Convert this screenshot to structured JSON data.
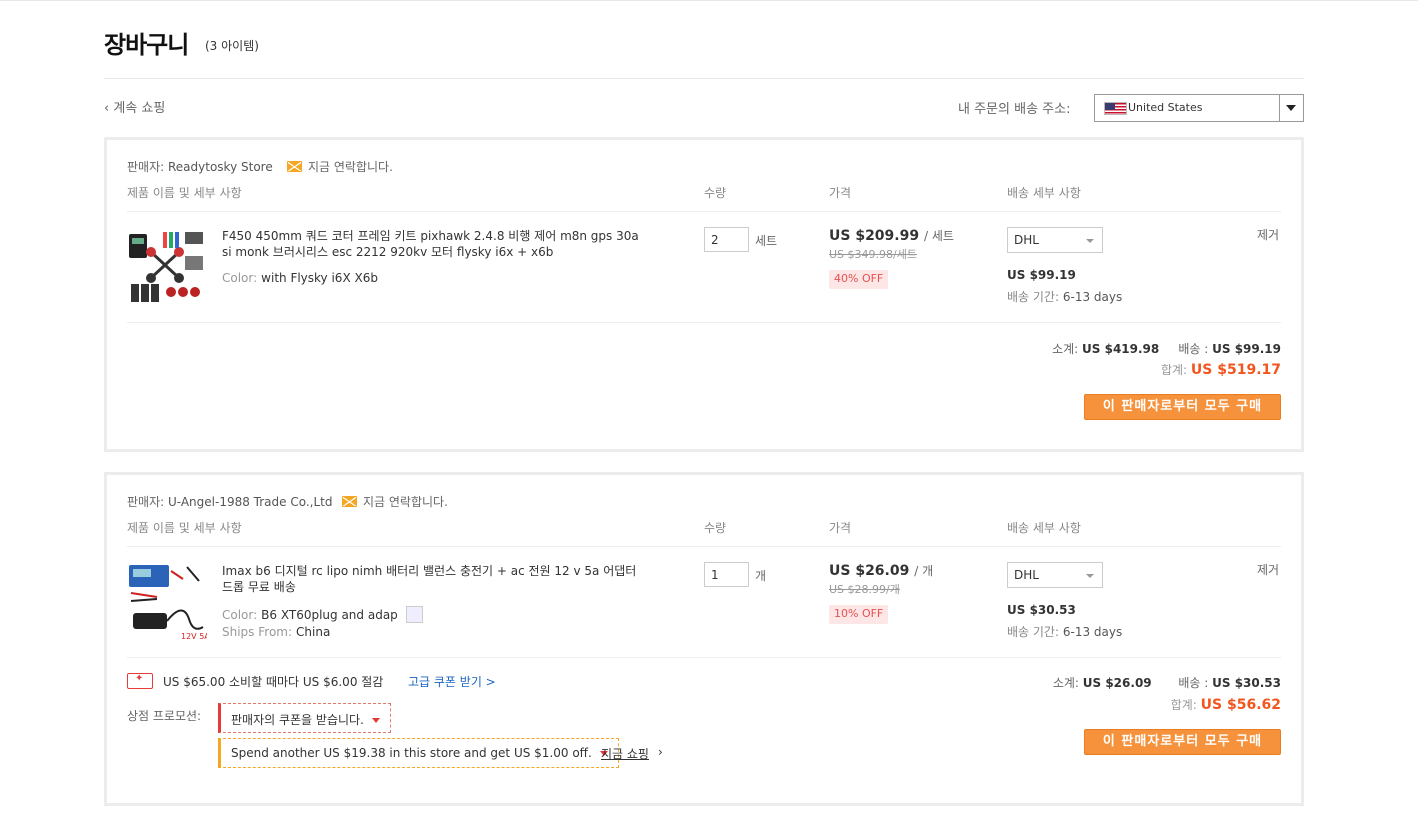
{
  "header": {
    "title": "장바구니",
    "count": "(3 아이템)",
    "continue_label": "‹ 계속 쇼핑",
    "ship_to_label": "내 주문의 배송 주소:",
    "country": "United States"
  },
  "columns": {
    "product": "제품 이름 및 세부 사항",
    "quantity": "수량",
    "price": "가격",
    "shipping": "배송 세부 사항"
  },
  "stores": [
    {
      "seller_label": "판매자:",
      "seller_name": "Readytosky Store",
      "contact_label": "지금 연락합니다.",
      "item": {
        "title": "F450 450mm 쿼드 코터 프레임 키트 pixhawk 2.4.8 비행 제어 m8n gps 30a si monk 브러시리스 esc 2212 920kv 모터 flysky i6x + x6b",
        "color_label": "Color:",
        "color_value": "with Flysky i6X X6b",
        "quantity": "2",
        "unit": "세트",
        "price": "US $209.99",
        "price_per": "/ 세트",
        "old_price": "US $349.98/세트",
        "discount": "40% OFF",
        "shipping_method": "DHL",
        "shipping_cost": "US $99.19",
        "delivery_label": "배송 기간:",
        "delivery_time": "6-13 days",
        "remove_label": "제거"
      },
      "subtotal_label": "소계:",
      "subtotal": "US $419.98",
      "shipping_label": "배송 :",
      "shipping_total": "US $99.19",
      "total_label": "합계:",
      "total": "US $519.17",
      "buy_label": "이 판매자로부터 모두 구매"
    },
    {
      "seller_label": "판매자:",
      "seller_name": "U-Angel-1988 Trade Co.,Ltd",
      "contact_label": "지금 연락합니다.",
      "item": {
        "title": "Imax b6 디지털 rc lipo nimh 배터리 밸런스 충전기 + ac 전원 12 v 5a 어댑터 드롭 무료 배송",
        "color_label": "Color:",
        "color_value": "B6 XT60plug and adap",
        "ships_from_label": "Ships From:",
        "ships_from": "China",
        "quantity": "1",
        "unit": "개",
        "price": "US $26.09",
        "price_per": "/ 개",
        "old_price": "US $28.99/개",
        "discount": "10% OFF",
        "shipping_method": "DHL",
        "shipping_cost": "US $30.53",
        "delivery_label": "배송 기간:",
        "delivery_time": "6-13 days",
        "remove_label": "제거"
      },
      "coupon_text": "US $65.00 소비할 때마다 US $6.00 절감",
      "coupon_link": "고급 쿠폰 받기 >",
      "promo_label": "상점 프로모션:",
      "promo_coupon": "판매자의 쿠폰을 받습니다.",
      "promo_spend": "Spend another US $19.38 in this store and get US $1.00 off.",
      "shop_now": "지금 쇼핑",
      "subtotal_label": "소계:",
      "subtotal": "US $26.09",
      "shipping_label": "배송 :",
      "shipping_total": "US $30.53",
      "total_label": "합계:",
      "total": "US $56.62",
      "buy_label": "이 판매자로부터 모두 구매"
    }
  ],
  "colors": {
    "accent_orange": "#f7923c",
    "total_red": "#f2551e",
    "discount_bg": "#fde6e6",
    "link_blue": "#1a66c2"
  }
}
